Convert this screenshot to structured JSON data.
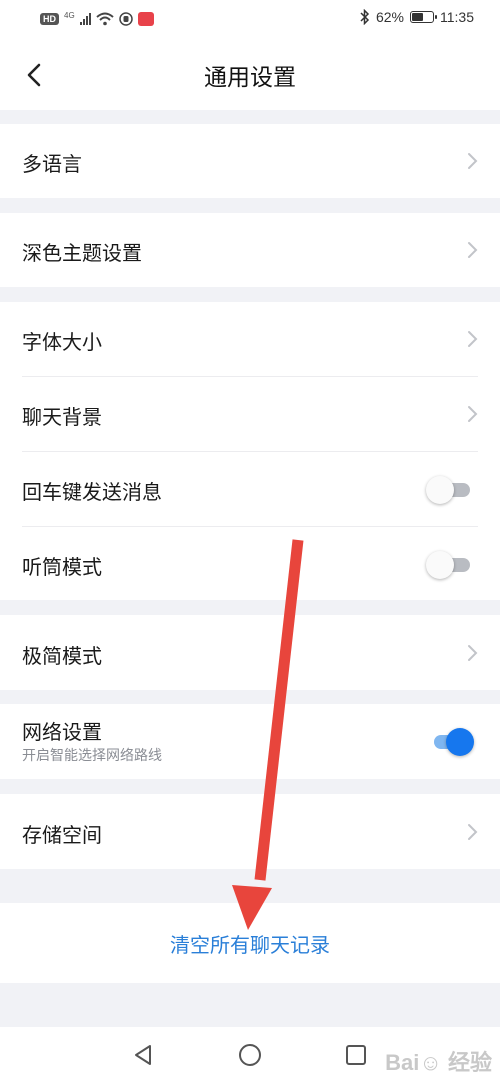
{
  "status_bar": {
    "hd": "HD",
    "network": "4G",
    "battery_percent": "62%",
    "battery_level": 0.62,
    "time": "11:35"
  },
  "header": {
    "title": "通用设置"
  },
  "settings": {
    "multi_language": "多语言",
    "dark_theme": "深色主题设置",
    "font_size": "字体大小",
    "chat_background": "聊天背景",
    "enter_to_send": {
      "label": "回车键发送消息",
      "on": false
    },
    "earpiece_mode": {
      "label": "听筒模式",
      "on": false
    },
    "minimal_mode": "极简模式",
    "network": {
      "label": "网络设置",
      "sublabel": "开启智能选择网络路线",
      "on": true
    },
    "storage": "存储空间"
  },
  "clear_chat_label": "清空所有聊天记录",
  "colors": {
    "accent": "#1677ee",
    "link": "#2a7fd8",
    "arrow": "#e8453c"
  },
  "icons": [
    "back-chevron-icon",
    "chevron-right-icon",
    "nav-back-icon",
    "nav-home-icon",
    "nav-recents-icon",
    "bluetooth-icon",
    "wifi-icon",
    "battery-icon"
  ],
  "watermark": "Bai du 经验"
}
